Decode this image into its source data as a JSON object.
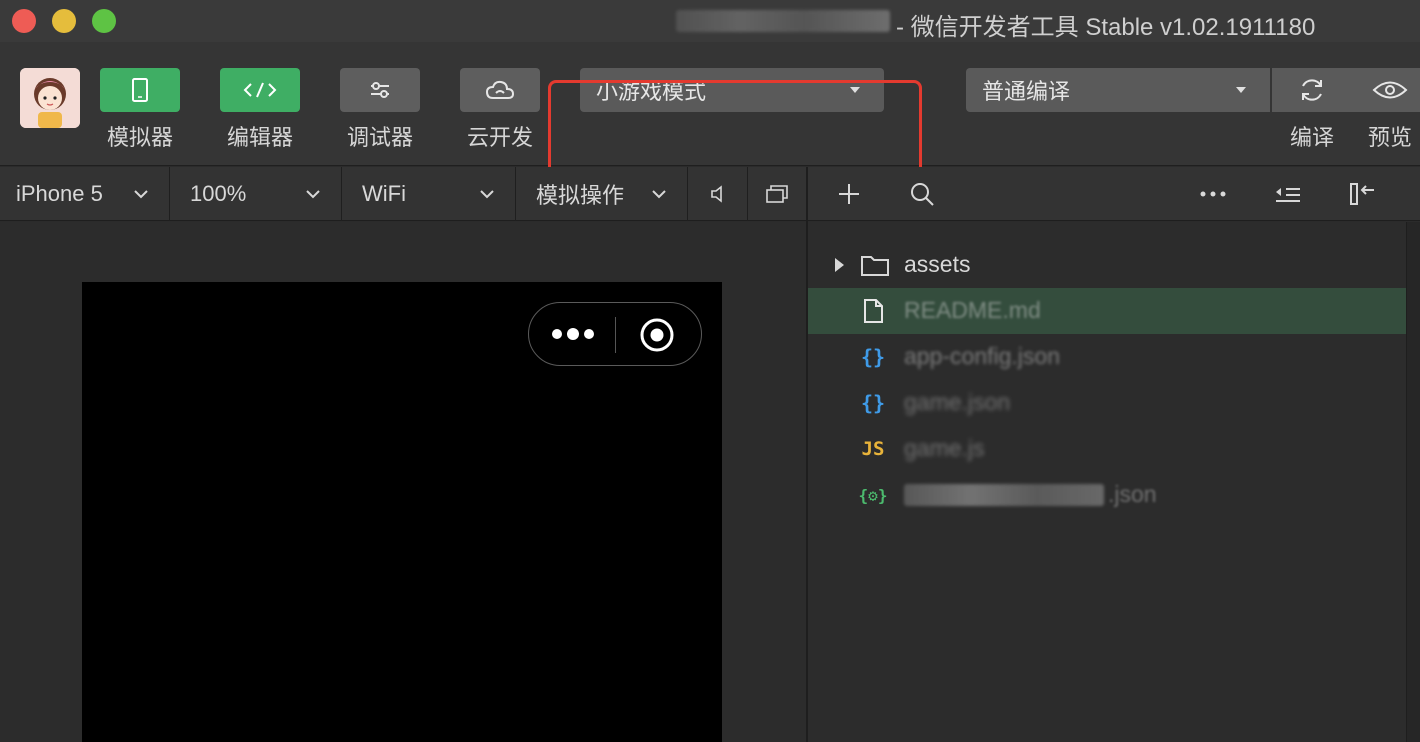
{
  "window": {
    "title": "- 微信开发者工具 Stable v1.02.1911180"
  },
  "toolbar": {
    "simulator_label": "模拟器",
    "editor_label": "编辑器",
    "debugger_label": "调试器",
    "cloud_label": "云开发",
    "mode_select": "小游戏模式",
    "compile_select": "普通编译",
    "compile_label": "编译",
    "preview_label": "预览"
  },
  "simbar": {
    "device": "iPhone 5",
    "zoom": "100%",
    "network": "WiFi",
    "operation": "模拟操作"
  },
  "files": [
    {
      "name": "assets",
      "icon": "folder-icon",
      "expandable": true
    },
    {
      "name": "README.md",
      "icon": "file-icon",
      "selected": true,
      "obscured": true
    },
    {
      "name": "app-config.json",
      "icon": "json-icon",
      "obscured": true
    },
    {
      "name": "game.json",
      "icon": "json-icon",
      "obscured": true
    },
    {
      "name": "game.js",
      "icon": "js-icon",
      "obscured": true
    },
    {
      "name": ".json",
      "icon": "settings-json-icon",
      "obscured": true
    }
  ],
  "colors": {
    "accent_green": "#3fae64",
    "highlight_red": "#e43a2f",
    "selected_row": "#344d3d"
  }
}
